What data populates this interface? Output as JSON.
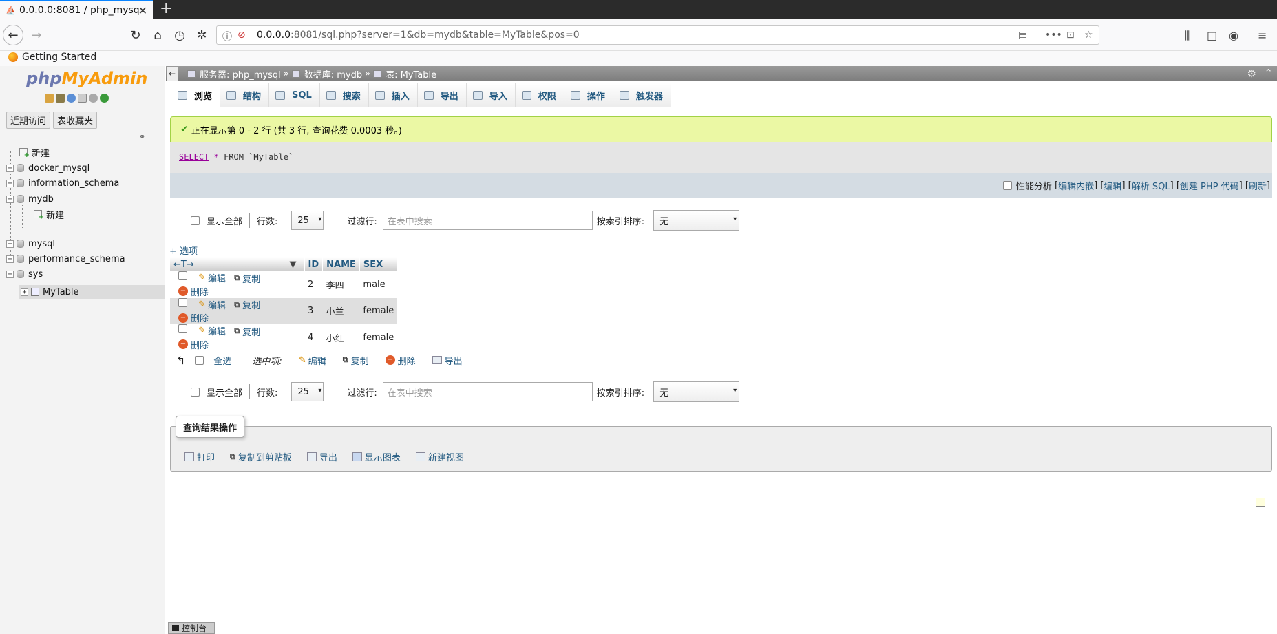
{
  "browser": {
    "tab_title": "0.0.0.0:8081 / php_mysq",
    "new_tab": "+",
    "url_host": "0.0.0.0",
    "url_rest": ":8081/sql.php?server=1&db=mydb&table=MyTable&pos=0",
    "bookmark": "Getting Started"
  },
  "sidebar": {
    "logo_php": "php",
    "logo_myadmin": "MyAdmin",
    "tab_recent": "近期访问",
    "tab_favorites": "表收藏夹",
    "tree": {
      "new": "新建",
      "docker_mysql": "docker_mysql",
      "information_schema": "information_schema",
      "mydb": "mydb",
      "mydb_new": "新建",
      "mytable": "MyTable",
      "mysql": "mysql",
      "performance_schema": "performance_schema",
      "sys": "sys"
    }
  },
  "breadcrumb": {
    "server": "服务器: php_mysql",
    "database": "数据库: mydb",
    "table": "表: MyTable",
    "sep": "»"
  },
  "menu_tabs": [
    "浏览",
    "结构",
    "SQL",
    "搜索",
    "插入",
    "导出",
    "导入",
    "权限",
    "操作",
    "触发器"
  ],
  "message": "正在显示第 0 - 2 行 (共 3 行, 查询花费 0.0003 秒。)",
  "sql": {
    "select": "SELECT",
    "star": "*",
    "from": "FROM `MyTable`"
  },
  "sql_tools": {
    "profiling": "性能分析",
    "edit_inline": "编辑内嵌",
    "edit": "编辑",
    "explain": "解析 SQL",
    "create_php": "创建 PHP 代码",
    "refresh": "刷新"
  },
  "nav": {
    "show_all": "显示全部",
    "rows_label": "行数:",
    "rows_value": "25",
    "filter_label": "过滤行:",
    "filter_placeholder": "在表中搜索",
    "sort_label": "按索引排序:",
    "sort_value": "无"
  },
  "options_link": "+ 选项",
  "table": {
    "arrows": "←T→",
    "columns": [
      "ID",
      "NAME",
      "SEX"
    ],
    "action_edit": "编辑",
    "action_copy": "复制",
    "action_delete": "删除",
    "rows": [
      {
        "id": "2",
        "name": "李四",
        "sex": "male"
      },
      {
        "id": "3",
        "name": "小兰",
        "sex": "female"
      },
      {
        "id": "4",
        "name": "小红",
        "sex": "female"
      }
    ]
  },
  "bulk": {
    "check_all": "全选",
    "with_selected": "选中项:",
    "edit": "编辑",
    "copy": "复制",
    "delete": "删除",
    "export": "导出"
  },
  "query_ops": {
    "legend": "查询结果操作",
    "print": "打印",
    "copy_clipboard": "复制到剪贴板",
    "export": "导出",
    "chart": "显示图表",
    "create_view": "新建视图"
  },
  "console": "控制台"
}
